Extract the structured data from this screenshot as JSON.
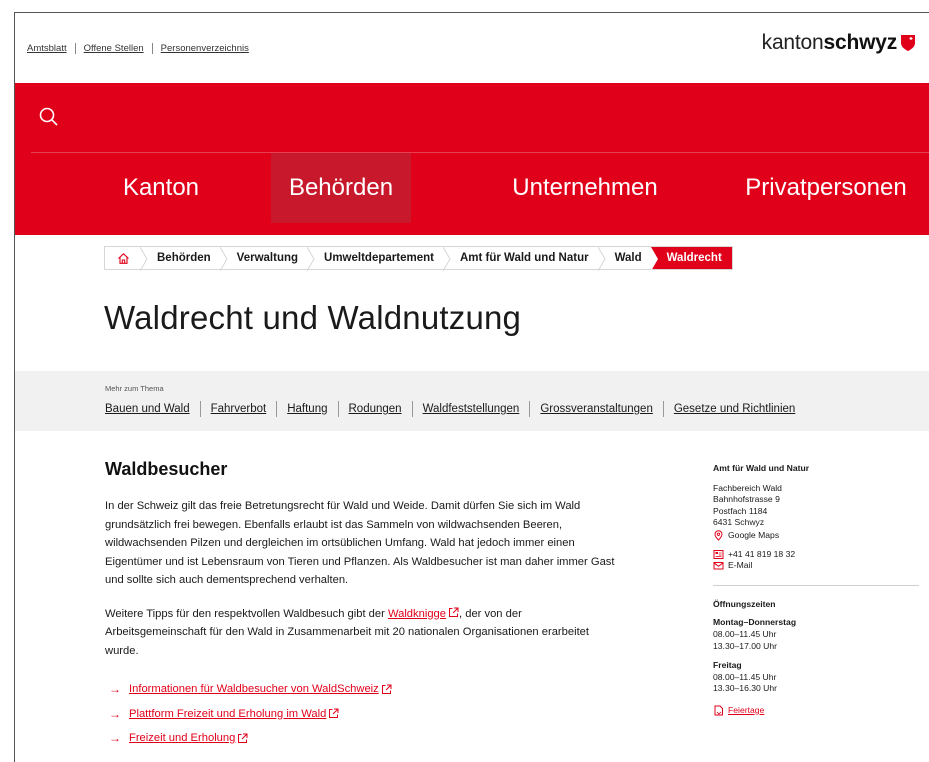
{
  "utility": {
    "links": [
      "Amtsblatt",
      "Offene Stellen",
      "Personenverzeichnis"
    ]
  },
  "logo": {
    "part1": "kanton",
    "part2": "schwyz"
  },
  "nav": {
    "items": [
      {
        "label": "Kanton"
      },
      {
        "label": "Behörden"
      },
      {
        "label": "Unternehmen"
      },
      {
        "label": "Privatpersonen"
      }
    ],
    "active": "Behörden"
  },
  "breadcrumb": {
    "items": [
      "Behörden",
      "Verwaltung",
      "Umweltdepartement",
      "Amt für Wald und Natur",
      "Wald"
    ],
    "current": "Waldrecht"
  },
  "page_title": "Waldrecht und Waldnutzung",
  "more": {
    "label": "Mehr zum Thema",
    "links": [
      "Bauen und Wald",
      "Fahrverbot",
      "Haftung",
      "Rodungen",
      "Waldfeststellungen",
      "Grossveranstaltungen",
      "Gesetze und Richtlinien"
    ]
  },
  "main": {
    "heading": "Waldbesucher",
    "paragraph1": "In der Schweiz gilt das freie Betretungsrecht für Wald und Weide. Damit dürfen Sie sich im Wald grundsätzlich frei bewegen. Ebenfalls erlaubt ist das Sammeln von wildwachsenden Beeren, wildwachsenden Pilzen und dergleichen im ortsüblichen Umfang. Wald hat jedoch immer einen Eigentümer und ist Lebensraum von Tieren und Pflanzen. Als Waldbesucher ist man daher immer Gast und sollte sich auch dementsprechend verhalten.",
    "paragraph2_before": "Weitere Tipps für den respektvollen Waldbesuch gibt der ",
    "paragraph2_link": "Waldknigge",
    "paragraph2_after": ", der von der Arbeitsgemeinschaft für den Wald in Zusammenarbeit mit 20 nationalen Organisationen erarbeitet wurde.",
    "links": [
      "Informationen für Waldbesucher von WaldSchweiz",
      "Plattform Freizeit und Erholung im Wald",
      "Freizeit und Erholung"
    ]
  },
  "sidebar": {
    "title": "Amt für Wald und Natur",
    "address": [
      "Fachbereich Wald",
      "Bahnhofstrasse 9",
      "Postfach 1184",
      "6431 Schwyz"
    ],
    "maps_label": "Google Maps",
    "phone": "+41 41 819 18 32",
    "email_label": "E-Mail",
    "hours_title": "Öffnungszeiten",
    "hours": [
      {
        "days": "Montag–Donnerstag",
        "times": [
          "08.00–11.45 Uhr",
          "13.30–17.00 Uhr"
        ]
      },
      {
        "days": "Freitag",
        "times": [
          "08.00–11.45 Uhr",
          "13.30–16.30 Uhr"
        ]
      }
    ],
    "holidays_label": "Feiertage"
  },
  "colors": {
    "brand_red": "#e1001a",
    "active_nav": "#c7192b",
    "topic_bar": "#f1f1f1"
  },
  "icons": [
    "search-icon",
    "home-icon",
    "external-link-icon",
    "map-pin-icon",
    "phone-icon",
    "mail-icon",
    "document-icon",
    "arrow-right-icon",
    "canton-shield-icon"
  ]
}
